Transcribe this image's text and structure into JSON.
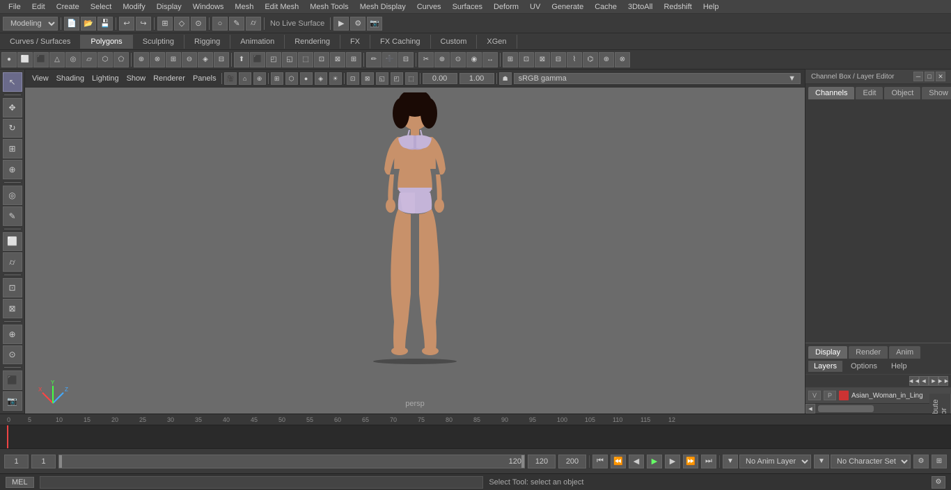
{
  "menubar": {
    "items": [
      "File",
      "Edit",
      "Create",
      "Select",
      "Modify",
      "Display",
      "Windows",
      "Mesh",
      "Edit Mesh",
      "Mesh Tools",
      "Mesh Display",
      "Curves",
      "Surfaces",
      "Deform",
      "UV",
      "Generate",
      "Cache",
      "3DtoAll",
      "Redshift",
      "Help"
    ]
  },
  "toolbar1": {
    "mode_label": "Modeling",
    "live_surface_label": "No Live Surface"
  },
  "tabs": {
    "items": [
      "Curves / Surfaces",
      "Polygons",
      "Sculpting",
      "Rigging",
      "Animation",
      "Rendering",
      "FX",
      "FX Caching",
      "Custom",
      "XGen"
    ],
    "active": "Polygons"
  },
  "viewport": {
    "menus": [
      "View",
      "Shading",
      "Lighting",
      "Show",
      "Renderer",
      "Panels"
    ],
    "label": "persp",
    "gamma": "sRGB gamma",
    "val1": "0.00",
    "val2": "1.00"
  },
  "channel_box": {
    "title": "Channel Box / Layer Editor",
    "tabs": [
      "Channels",
      "Edit",
      "Object",
      "Show"
    ]
  },
  "layers": {
    "tabs": [
      "Display",
      "Render",
      "Anim"
    ],
    "active": "Display",
    "sub_tabs": [
      "Layers",
      "Options",
      "Help"
    ],
    "layer_name": "Asian_Woman_in_Ling",
    "layer_color": "#cc3333"
  },
  "timeline": {
    "markers": [
      "0",
      "5",
      "10",
      "15",
      "20",
      "25",
      "30",
      "35",
      "40",
      "45",
      "50",
      "55",
      "60",
      "65",
      "70",
      "75",
      "80",
      "85",
      "90",
      "95",
      "100",
      "105",
      "110",
      "115",
      "12"
    ],
    "current_frame": "1"
  },
  "bottom_controls": {
    "frame_start": "1",
    "frame_current": "1",
    "frame_range_input": "120",
    "frame_end1": "120",
    "frame_end2": "200",
    "anim_layer": "No Anim Layer",
    "char_set": "No Character Set"
  },
  "status_bar": {
    "mode": "MEL",
    "message": "Select Tool: select an object"
  },
  "playback_icons": [
    "⏮",
    "⏪",
    "◀",
    "▶",
    "⏩",
    "⏭"
  ],
  "icons": {
    "arrow": "↖",
    "move": "✥",
    "rotate": "↻",
    "scale": "⊞",
    "gear": "⚙",
    "close": "✕",
    "chevron_left": "◄",
    "chevron_right": "►",
    "chevron_down": "▼",
    "chevron_up": "▲"
  }
}
